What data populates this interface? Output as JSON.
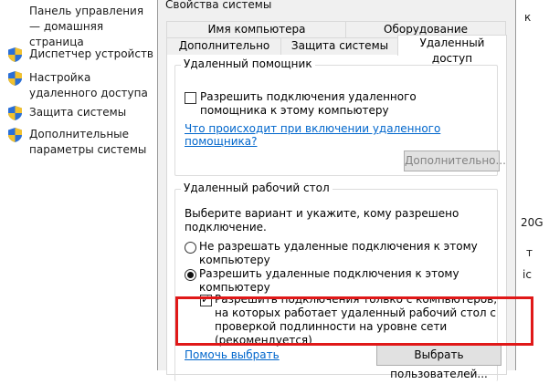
{
  "sidebar": {
    "home_link": "Панель управления — домашняя страница",
    "items": [
      {
        "label": "Диспетчер устройств",
        "icon": "shield-icon"
      },
      {
        "label": "Настройка удаленного доступа",
        "icon": "shield-icon"
      },
      {
        "label": "Защита системы",
        "icon": "shield-icon"
      },
      {
        "label": "Дополнительные параметры системы",
        "icon": "shield-icon"
      }
    ]
  },
  "right_strip": {
    "frag1": "к",
    "frag2": "20G",
    "frag3": "т",
    "frag4": "іс"
  },
  "dialog": {
    "title": "Свойства системы",
    "tabs_row1": [
      "Имя компьютера",
      "Оборудование"
    ],
    "tabs_row2": [
      "Дополнительно",
      "Защита системы",
      "Удаленный доступ"
    ],
    "active_tab": "Удаленный доступ",
    "remote_assistance": {
      "group_title": "Удаленный помощник",
      "checkbox_label": "Разрешить подключения удаленного помощника к этому компьютеру",
      "checkbox_checked": false,
      "info_link": "Что происходит при включении удаленного помощника?",
      "advanced_button": "Дополнительно..."
    },
    "remote_desktop": {
      "group_title": "Удаленный рабочий стол",
      "instruction": "Выберите вариант и укажите, кому разрешено подключение.",
      "option_deny": "Не разрешать удаленные подключения к этому компьютеру",
      "option_allow": "Разрешить удаленные подключения к этому компьютеру",
      "selected": "allow",
      "nla_label": "Разрешить подключения только с компьютеров, на которых работает удаленный рабочий стол с проверкой подлинности на уровне сети (рекомендуется)",
      "nla_checked": true,
      "help_link": "Помочь выбрать",
      "select_users_button": "Выбрать пользователей..."
    }
  },
  "colors": {
    "highlight": "#e01818",
    "link": "#0066cc",
    "shield_blue": "#2a6fd6",
    "shield_yellow": "#f2c12e"
  }
}
